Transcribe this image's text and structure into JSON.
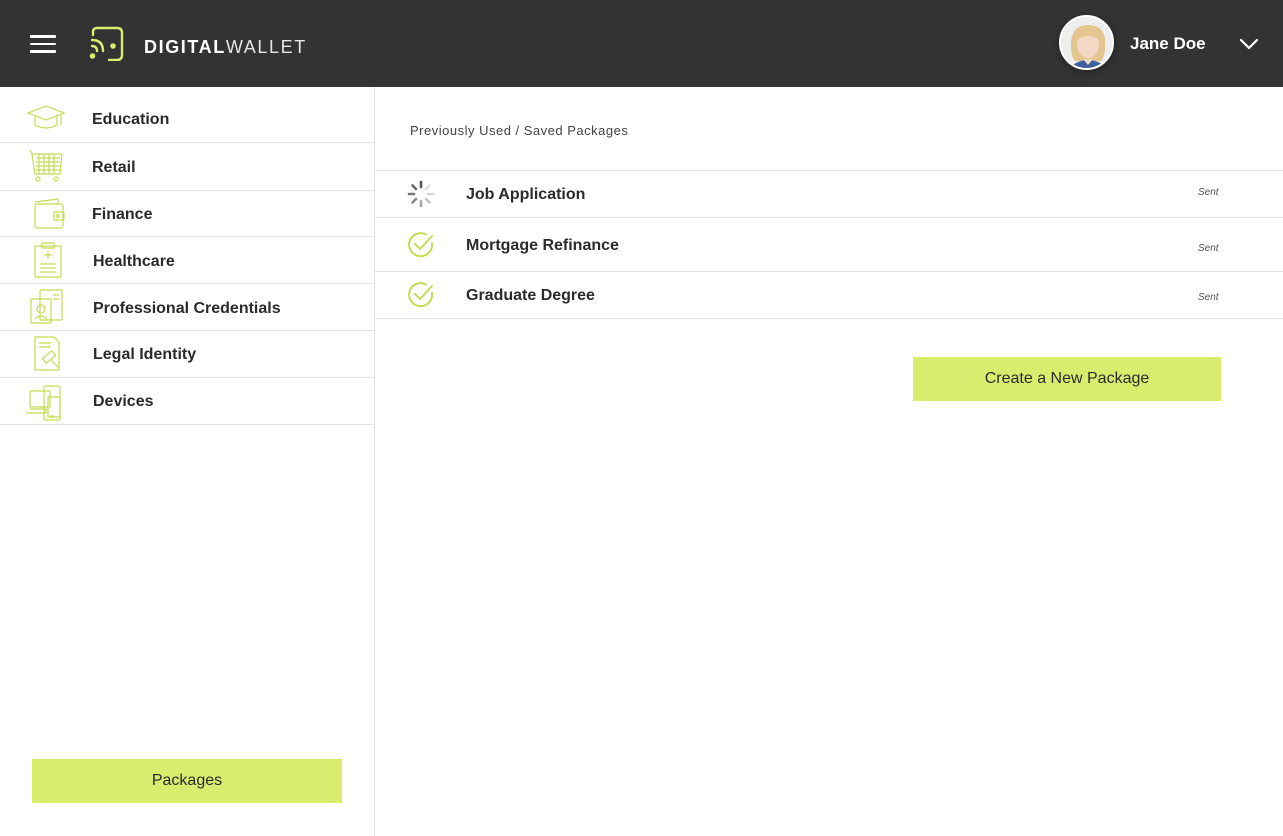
{
  "header": {
    "brand_bold": "DIGITAL",
    "brand_light": "WALLET",
    "user_name": "Jane Doe",
    "menu_icon": "hamburger-menu-icon",
    "logo_icon": "wallet-signal-logo-icon",
    "dropdown_icon": "chevron-down-icon"
  },
  "sidebar": {
    "items": [
      {
        "label": "Education",
        "icon": "graduation-cap-icon"
      },
      {
        "label": "Retail",
        "icon": "shopping-cart-icon"
      },
      {
        "label": "Finance",
        "icon": "wallet-icon"
      },
      {
        "label": "Healthcare",
        "icon": "medical-clipboard-icon"
      },
      {
        "label": "Professional Credentials",
        "icon": "id-badge-icon"
      },
      {
        "label": "Legal Identity",
        "icon": "legal-document-gavel-icon"
      },
      {
        "label": "Devices",
        "icon": "laptop-phone-icon"
      }
    ],
    "packages_label": "Packages"
  },
  "main": {
    "breadcrumb": "Previously Used / Saved Packages",
    "packages": [
      {
        "name": "Job Application",
        "status": "Sent",
        "state_icon": "loading-spinner-icon"
      },
      {
        "name": "Mortgage Refinance",
        "status": "Sent",
        "state_icon": "check-circle-icon"
      },
      {
        "name": "Graduate Degree",
        "status": "Sent",
        "state_icon": "check-circle-icon"
      }
    ],
    "create_label": "Create a New Package"
  },
  "colors": {
    "header_bg": "#333333",
    "accent": "#d9ec6d",
    "icon_green": "#c3dc55",
    "divider": "#e3e3e3"
  }
}
